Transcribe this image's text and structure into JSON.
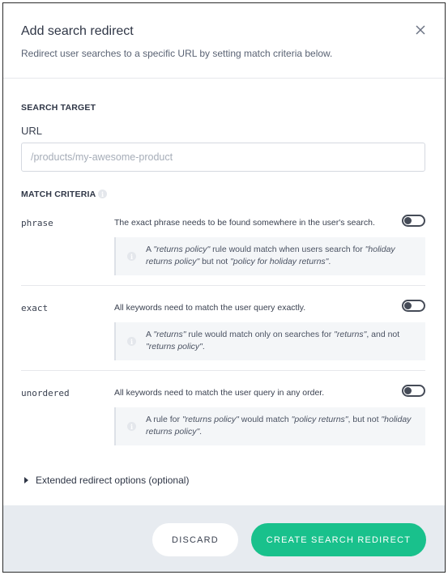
{
  "header": {
    "title": "Add search redirect",
    "subtitle": "Redirect user searches to a specific URL by setting match criteria below."
  },
  "search_target": {
    "section_label": "SEARCH TARGET",
    "url_label": "URL",
    "url_placeholder": "/products/my-awesome-product",
    "url_value": ""
  },
  "match_criteria": {
    "section_label": "MATCH CRITERIA",
    "items": [
      {
        "name": "phrase",
        "description": "The exact phrase needs to be found somewhere in the user's search.",
        "enabled": false,
        "example_parts": [
          "A ",
          "\"returns policy\"",
          " rule would match when users search for ",
          "\"holiday returns policy\"",
          " but not ",
          "\"policy for holiday returns\"",
          "."
        ]
      },
      {
        "name": "exact",
        "description": "All keywords need to match the user query exactly.",
        "enabled": false,
        "example_parts": [
          "A ",
          "\"returns\"",
          " rule would match only on searches for ",
          "\"returns\"",
          ", and not ",
          "\"returns policy\"",
          "."
        ]
      },
      {
        "name": "unordered",
        "description": "All keywords need to match the user query in any order.",
        "enabled": false,
        "example_parts": [
          "A rule for ",
          "\"returns policy\"",
          " would match ",
          "\"policy returns\"",
          ", but not ",
          "\"holiday returns policy\"",
          "."
        ]
      }
    ]
  },
  "extended_options_label": "Extended redirect options (optional)",
  "footer": {
    "discard_label": "DISCARD",
    "create_label": "CREATE SEARCH REDIRECT"
  },
  "colors": {
    "primary": "#19c18c",
    "footer_bg": "#e7ebf0",
    "example_bg": "#f4f6f8"
  }
}
